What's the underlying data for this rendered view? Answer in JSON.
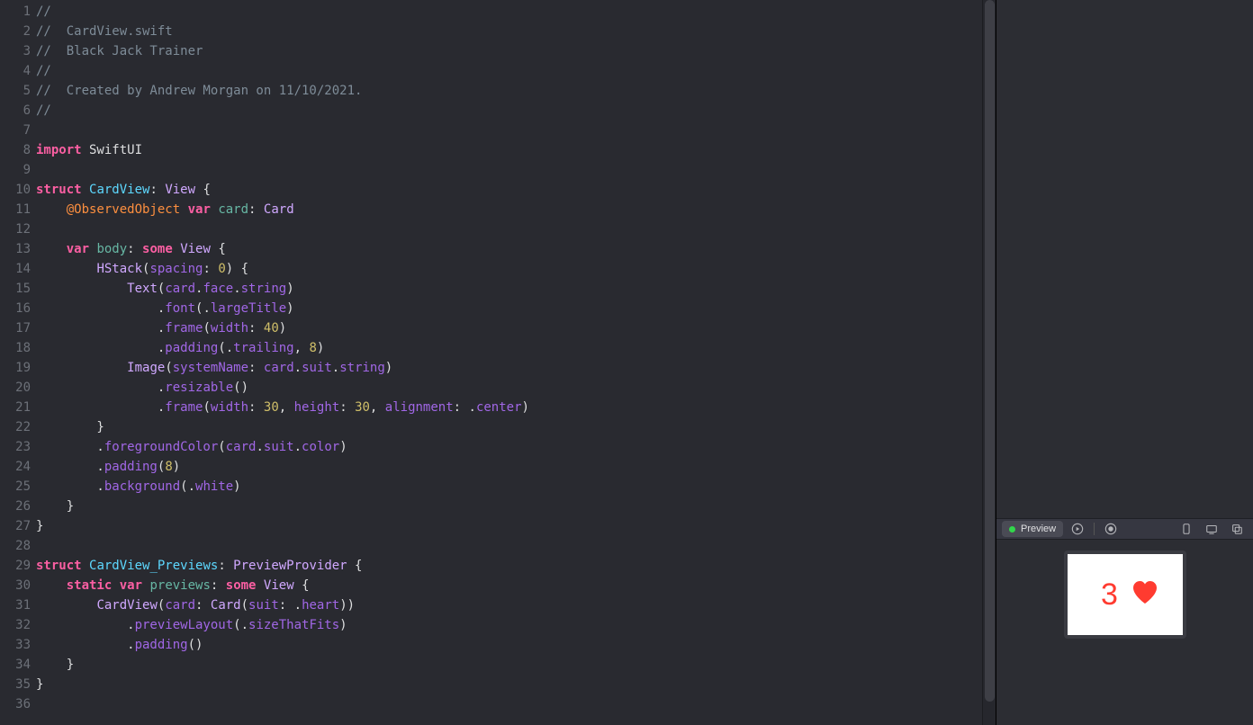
{
  "code": {
    "lines": [
      {
        "n": "1",
        "tokens": [
          {
            "c": "tok-comment",
            "t": "//"
          }
        ]
      },
      {
        "n": "2",
        "tokens": [
          {
            "c": "tok-comment",
            "t": "//  CardView.swift"
          }
        ]
      },
      {
        "n": "3",
        "tokens": [
          {
            "c": "tok-comment",
            "t": "//  Black Jack Trainer"
          }
        ]
      },
      {
        "n": "4",
        "tokens": [
          {
            "c": "tok-comment",
            "t": "//"
          }
        ]
      },
      {
        "n": "5",
        "tokens": [
          {
            "c": "tok-comment",
            "t": "//  Created by Andrew Morgan on 11/10/2021."
          }
        ]
      },
      {
        "n": "6",
        "tokens": [
          {
            "c": "tok-comment",
            "t": "//"
          }
        ]
      },
      {
        "n": "7",
        "tokens": []
      },
      {
        "n": "8",
        "tokens": [
          {
            "c": "tok-keyword",
            "t": "import"
          },
          {
            "c": "tok-plain",
            "t": " SwiftUI"
          }
        ]
      },
      {
        "n": "9",
        "tokens": []
      },
      {
        "n": "10",
        "tokens": [
          {
            "c": "tok-keyword",
            "t": "struct"
          },
          {
            "c": "tok-plain",
            "t": " "
          },
          {
            "c": "tok-type-decl",
            "t": "CardView"
          },
          {
            "c": "tok-plain",
            "t": ": "
          },
          {
            "c": "tok-type-sys",
            "t": "View"
          },
          {
            "c": "tok-plain",
            "t": " {"
          }
        ]
      },
      {
        "n": "11",
        "tokens": [
          {
            "c": "tok-plain",
            "t": "    "
          },
          {
            "c": "tok-attr",
            "t": "@ObservedObject"
          },
          {
            "c": "tok-plain",
            "t": " "
          },
          {
            "c": "tok-keyword",
            "t": "var"
          },
          {
            "c": "tok-plain",
            "t": " "
          },
          {
            "c": "tok-prop-decl",
            "t": "card"
          },
          {
            "c": "tok-plain",
            "t": ": "
          },
          {
            "c": "tok-type-sys",
            "t": "Card"
          }
        ]
      },
      {
        "n": "12",
        "tokens": []
      },
      {
        "n": "13",
        "tokens": [
          {
            "c": "tok-plain",
            "t": "    "
          },
          {
            "c": "tok-keyword",
            "t": "var"
          },
          {
            "c": "tok-plain",
            "t": " "
          },
          {
            "c": "tok-prop-decl",
            "t": "body"
          },
          {
            "c": "tok-plain",
            "t": ": "
          },
          {
            "c": "tok-keyword",
            "t": "some"
          },
          {
            "c": "tok-plain",
            "t": " "
          },
          {
            "c": "tok-type-sys",
            "t": "View"
          },
          {
            "c": "tok-plain",
            "t": " {"
          }
        ]
      },
      {
        "n": "14",
        "tokens": [
          {
            "c": "tok-plain",
            "t": "        "
          },
          {
            "c": "tok-type-sys",
            "t": "HStack"
          },
          {
            "c": "tok-plain",
            "t": "("
          },
          {
            "c": "tok-member",
            "t": "spacing"
          },
          {
            "c": "tok-plain",
            "t": ": "
          },
          {
            "c": "tok-num",
            "t": "0"
          },
          {
            "c": "tok-plain",
            "t": ") {"
          }
        ]
      },
      {
        "n": "15",
        "tokens": [
          {
            "c": "tok-plain",
            "t": "            "
          },
          {
            "c": "tok-type-sys",
            "t": "Text"
          },
          {
            "c": "tok-plain",
            "t": "("
          },
          {
            "c": "tok-member",
            "t": "card"
          },
          {
            "c": "tok-plain",
            "t": "."
          },
          {
            "c": "tok-member",
            "t": "face"
          },
          {
            "c": "tok-plain",
            "t": "."
          },
          {
            "c": "tok-member",
            "t": "string"
          },
          {
            "c": "tok-plain",
            "t": ")"
          }
        ]
      },
      {
        "n": "16",
        "tokens": [
          {
            "c": "tok-plain",
            "t": "                ."
          },
          {
            "c": "tok-member",
            "t": "font"
          },
          {
            "c": "tok-plain",
            "t": "(."
          },
          {
            "c": "tok-member",
            "t": "largeTitle"
          },
          {
            "c": "tok-plain",
            "t": ")"
          }
        ]
      },
      {
        "n": "17",
        "tokens": [
          {
            "c": "tok-plain",
            "t": "                ."
          },
          {
            "c": "tok-member",
            "t": "frame"
          },
          {
            "c": "tok-plain",
            "t": "("
          },
          {
            "c": "tok-member",
            "t": "width"
          },
          {
            "c": "tok-plain",
            "t": ": "
          },
          {
            "c": "tok-num",
            "t": "40"
          },
          {
            "c": "tok-plain",
            "t": ")"
          }
        ]
      },
      {
        "n": "18",
        "tokens": [
          {
            "c": "tok-plain",
            "t": "                ."
          },
          {
            "c": "tok-member",
            "t": "padding"
          },
          {
            "c": "tok-plain",
            "t": "(."
          },
          {
            "c": "tok-member",
            "t": "trailing"
          },
          {
            "c": "tok-plain",
            "t": ", "
          },
          {
            "c": "tok-num",
            "t": "8"
          },
          {
            "c": "tok-plain",
            "t": ")"
          }
        ]
      },
      {
        "n": "19",
        "tokens": [
          {
            "c": "tok-plain",
            "t": "            "
          },
          {
            "c": "tok-type-sys",
            "t": "Image"
          },
          {
            "c": "tok-plain",
            "t": "("
          },
          {
            "c": "tok-member",
            "t": "systemName"
          },
          {
            "c": "tok-plain",
            "t": ": "
          },
          {
            "c": "tok-member",
            "t": "card"
          },
          {
            "c": "tok-plain",
            "t": "."
          },
          {
            "c": "tok-member",
            "t": "suit"
          },
          {
            "c": "tok-plain",
            "t": "."
          },
          {
            "c": "tok-member",
            "t": "string"
          },
          {
            "c": "tok-plain",
            "t": ")"
          }
        ]
      },
      {
        "n": "20",
        "tokens": [
          {
            "c": "tok-plain",
            "t": "                ."
          },
          {
            "c": "tok-member",
            "t": "resizable"
          },
          {
            "c": "tok-plain",
            "t": "()"
          }
        ]
      },
      {
        "n": "21",
        "tokens": [
          {
            "c": "tok-plain",
            "t": "                ."
          },
          {
            "c": "tok-member",
            "t": "frame"
          },
          {
            "c": "tok-plain",
            "t": "("
          },
          {
            "c": "tok-member",
            "t": "width"
          },
          {
            "c": "tok-plain",
            "t": ": "
          },
          {
            "c": "tok-num",
            "t": "30"
          },
          {
            "c": "tok-plain",
            "t": ", "
          },
          {
            "c": "tok-member",
            "t": "height"
          },
          {
            "c": "tok-plain",
            "t": ": "
          },
          {
            "c": "tok-num",
            "t": "30"
          },
          {
            "c": "tok-plain",
            "t": ", "
          },
          {
            "c": "tok-member",
            "t": "alignment"
          },
          {
            "c": "tok-plain",
            "t": ": ."
          },
          {
            "c": "tok-member",
            "t": "center"
          },
          {
            "c": "tok-plain",
            "t": ")"
          }
        ]
      },
      {
        "n": "22",
        "tokens": [
          {
            "c": "tok-plain",
            "t": "        }"
          }
        ]
      },
      {
        "n": "23",
        "tokens": [
          {
            "c": "tok-plain",
            "t": "        ."
          },
          {
            "c": "tok-member",
            "t": "foregroundColor"
          },
          {
            "c": "tok-plain",
            "t": "("
          },
          {
            "c": "tok-member",
            "t": "card"
          },
          {
            "c": "tok-plain",
            "t": "."
          },
          {
            "c": "tok-member",
            "t": "suit"
          },
          {
            "c": "tok-plain",
            "t": "."
          },
          {
            "c": "tok-member",
            "t": "color"
          },
          {
            "c": "tok-plain",
            "t": ")"
          }
        ]
      },
      {
        "n": "24",
        "tokens": [
          {
            "c": "tok-plain",
            "t": "        ."
          },
          {
            "c": "tok-member",
            "t": "padding"
          },
          {
            "c": "tok-plain",
            "t": "("
          },
          {
            "c": "tok-num",
            "t": "8"
          },
          {
            "c": "tok-plain",
            "t": ")"
          }
        ]
      },
      {
        "n": "25",
        "tokens": [
          {
            "c": "tok-plain",
            "t": "        ."
          },
          {
            "c": "tok-member",
            "t": "background"
          },
          {
            "c": "tok-plain",
            "t": "(."
          },
          {
            "c": "tok-member",
            "t": "white"
          },
          {
            "c": "tok-plain",
            "t": ")"
          }
        ]
      },
      {
        "n": "26",
        "tokens": [
          {
            "c": "tok-plain",
            "t": "    }"
          }
        ]
      },
      {
        "n": "27",
        "tokens": [
          {
            "c": "tok-plain",
            "t": "}"
          }
        ]
      },
      {
        "n": "28",
        "tokens": []
      },
      {
        "n": "29",
        "tokens": [
          {
            "c": "tok-keyword",
            "t": "struct"
          },
          {
            "c": "tok-plain",
            "t": " "
          },
          {
            "c": "tok-type-decl",
            "t": "CardView_Previews"
          },
          {
            "c": "tok-plain",
            "t": ": "
          },
          {
            "c": "tok-type-sys",
            "t": "PreviewProvider"
          },
          {
            "c": "tok-plain",
            "t": " {"
          }
        ]
      },
      {
        "n": "30",
        "tokens": [
          {
            "c": "tok-plain",
            "t": "    "
          },
          {
            "c": "tok-keyword",
            "t": "static"
          },
          {
            "c": "tok-plain",
            "t": " "
          },
          {
            "c": "tok-keyword",
            "t": "var"
          },
          {
            "c": "tok-plain",
            "t": " "
          },
          {
            "c": "tok-prop-decl",
            "t": "previews"
          },
          {
            "c": "tok-plain",
            "t": ": "
          },
          {
            "c": "tok-keyword",
            "t": "some"
          },
          {
            "c": "tok-plain",
            "t": " "
          },
          {
            "c": "tok-type-sys",
            "t": "View"
          },
          {
            "c": "tok-plain",
            "t": " {"
          }
        ]
      },
      {
        "n": "31",
        "tokens": [
          {
            "c": "tok-plain",
            "t": "        "
          },
          {
            "c": "tok-type-sys",
            "t": "CardView"
          },
          {
            "c": "tok-plain",
            "t": "("
          },
          {
            "c": "tok-member",
            "t": "card"
          },
          {
            "c": "tok-plain",
            "t": ": "
          },
          {
            "c": "tok-type-sys",
            "t": "Card"
          },
          {
            "c": "tok-plain",
            "t": "("
          },
          {
            "c": "tok-member",
            "t": "suit"
          },
          {
            "c": "tok-plain",
            "t": ": ."
          },
          {
            "c": "tok-member",
            "t": "heart"
          },
          {
            "c": "tok-plain",
            "t": "))"
          }
        ]
      },
      {
        "n": "32",
        "tokens": [
          {
            "c": "tok-plain",
            "t": "            ."
          },
          {
            "c": "tok-member",
            "t": "previewLayout"
          },
          {
            "c": "tok-plain",
            "t": "(."
          },
          {
            "c": "tok-member",
            "t": "sizeThatFits"
          },
          {
            "c": "tok-plain",
            "t": ")"
          }
        ]
      },
      {
        "n": "33",
        "tokens": [
          {
            "c": "tok-plain",
            "t": "            ."
          },
          {
            "c": "tok-member",
            "t": "padding"
          },
          {
            "c": "tok-plain",
            "t": "()"
          }
        ]
      },
      {
        "n": "34",
        "tokens": [
          {
            "c": "tok-plain",
            "t": "    }"
          }
        ]
      },
      {
        "n": "35",
        "tokens": [
          {
            "c": "tok-plain",
            "t": "}"
          }
        ]
      },
      {
        "n": "36",
        "tokens": []
      }
    ]
  },
  "preview": {
    "toolbar": {
      "label": "Preview"
    },
    "card_face": "3",
    "card_color": "#FF3B30"
  }
}
